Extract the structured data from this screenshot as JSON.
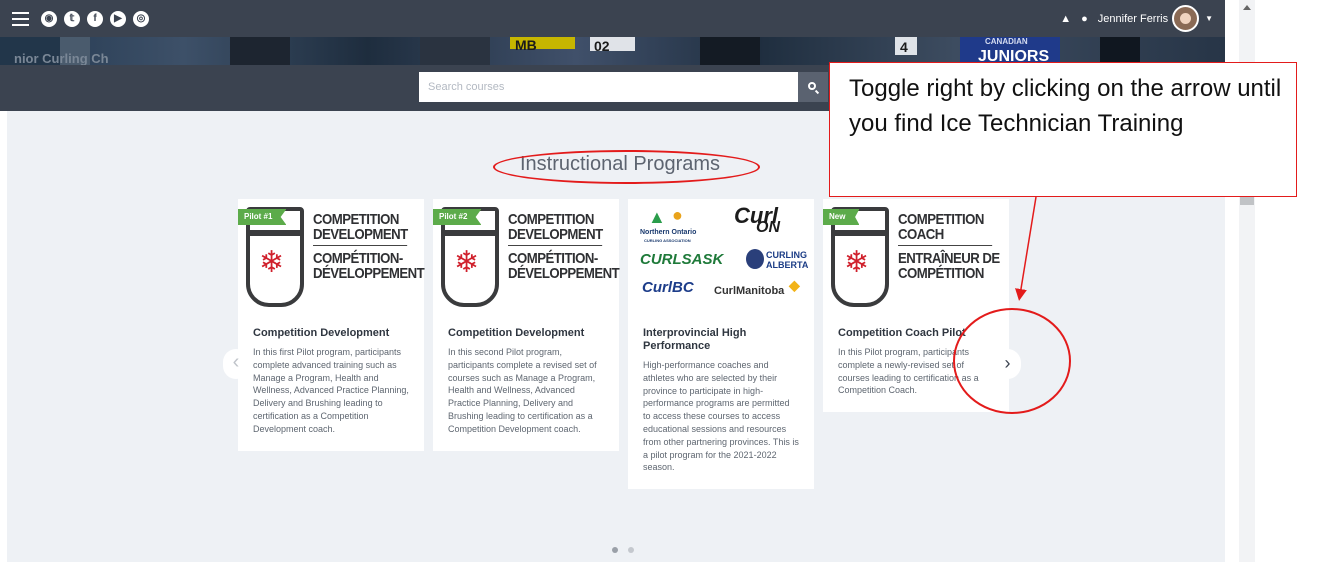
{
  "header": {
    "user_name": "Jennifer Ferris",
    "social_icons": [
      "globe-icon",
      "twitter-icon",
      "facebook-icon",
      "youtube-icon",
      "instagram-icon"
    ],
    "social_glyphs": [
      "◉",
      "𝕥",
      "f",
      "▶",
      "◎"
    ]
  },
  "banner": {
    "text_left": "nior Curling Ch",
    "text_mb": "MB",
    "text_02": "02",
    "text_4": "4",
    "text_canadian": "CANADIAN",
    "text_juniors": "JUNIORS"
  },
  "search": {
    "placeholder": "Search courses"
  },
  "section": {
    "heading": "Instructional Programs"
  },
  "cards": [
    {
      "tag": "Pilot #1",
      "logo_line1": "COMPETITION",
      "logo_line2": "DEVELOPMENT",
      "logo_line3": "COMPÉTITION-",
      "logo_line4": "DÉVELOPPEMENT",
      "title": "Competition Development",
      "description": "In this first Pilot program, participants complete advanced training such as Manage a Program, Health and Wellness, Advanced Practice Planning, Delivery and Brushing leading to certification as a Competition Development coach."
    },
    {
      "tag": "Pilot #2",
      "logo_line1": "COMPETITION",
      "logo_line2": "DEVELOPMENT",
      "logo_line3": "COMPÉTITION-",
      "logo_line4": "DÉVELOPPEMENT",
      "title": "Competition Development",
      "description": "In this second Pilot program, participants complete a revised set of courses such as Manage a Program, Health and Wellness, Advanced Practice Planning, Delivery and Brushing leading to certification as a Competition Development coach."
    },
    {
      "partners": {
        "northern_ontario": "Northern Ontario",
        "northern_ontario_sub": "CURLING ASSOCIATION",
        "curl": "Curl",
        "on": "ON",
        "curlsask": "CURLSASK",
        "curling_alberta_1": "CURLING",
        "curling_alberta_2": "ALBERTA",
        "curlbc": "CurlBC",
        "curlmanitoba": "CurlManitoba"
      },
      "title": "Interprovincial High Performance",
      "description": "High-performance coaches and athletes who are selected by their province to participate in high-performance programs are permitted to access these courses to access educational sessions and resources from other partnering provinces. This is a pilot program for the 2021-2022 season."
    },
    {
      "tag": "New",
      "logo_line1": "COMPETITION",
      "logo_line2": "COACH",
      "logo_line3": "ENTRAÎNEUR DE",
      "logo_line4": "COMPÉTITION",
      "title": "Competition Coach Pilot",
      "description": "In this Pilot program, participants complete a newly-revised set of courses leading to certification as a Competition Coach."
    }
  ],
  "carousel": {
    "prev_glyph": "‹",
    "next_glyph": "›"
  },
  "annotation": {
    "callout_text": "Toggle right by clicking on the arrow until you find Ice Technician Training",
    "color": "#e31b1b"
  },
  "colors": {
    "topbar": "#3b4350",
    "content_bg": "#eef1f5",
    "tag_green": "#5cab4a",
    "maple_red": "#d0202c"
  }
}
